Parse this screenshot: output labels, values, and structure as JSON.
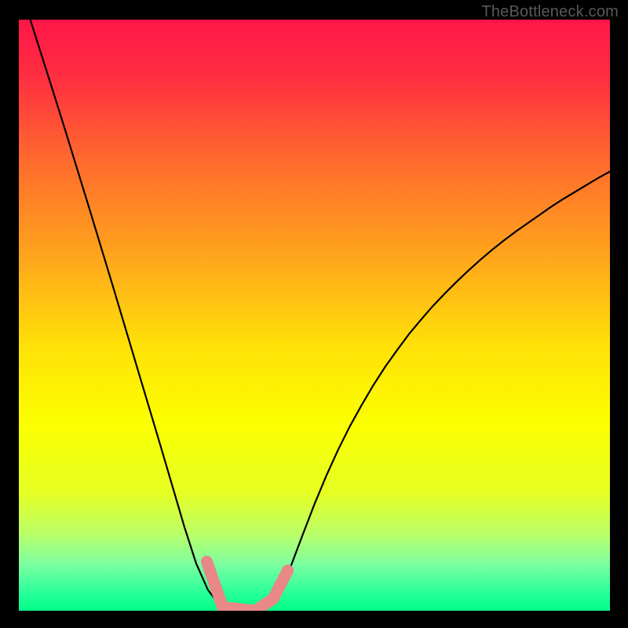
{
  "watermark": "TheBottleneck.com",
  "colors": {
    "gradient_stops": [
      {
        "offset": 0.0,
        "color": "#ff1648"
      },
      {
        "offset": 0.1,
        "color": "#ff2f40"
      },
      {
        "offset": 0.25,
        "color": "#ff6f2c"
      },
      {
        "offset": 0.4,
        "color": "#ffa51c"
      },
      {
        "offset": 0.55,
        "color": "#ffe008"
      },
      {
        "offset": 0.68,
        "color": "#fcff00"
      },
      {
        "offset": 0.8,
        "color": "#e6ff23"
      },
      {
        "offset": 0.87,
        "color": "#baff68"
      },
      {
        "offset": 0.92,
        "color": "#7fffa0"
      },
      {
        "offset": 0.97,
        "color": "#28ff9a"
      },
      {
        "offset": 1.0,
        "color": "#00ff88"
      }
    ],
    "curve_stroke": "#000000",
    "stub_stroke": "#e98886",
    "background": "#000000"
  },
  "chart_data": {
    "type": "line",
    "title": "",
    "xlabel": "",
    "ylabel": "",
    "x": [
      0.0,
      0.02,
      0.04,
      0.06,
      0.08,
      0.1,
      0.12,
      0.14,
      0.16,
      0.18,
      0.2,
      0.22,
      0.24,
      0.26,
      0.28,
      0.3,
      0.32,
      0.34,
      0.355,
      0.37,
      0.385,
      0.4,
      0.42,
      0.44,
      0.46,
      0.48,
      0.5,
      0.52,
      0.54,
      0.56,
      0.58,
      0.6,
      0.62,
      0.64,
      0.66,
      0.68,
      0.7,
      0.72,
      0.74,
      0.76,
      0.78,
      0.8,
      0.82,
      0.84,
      0.86,
      0.88,
      0.9,
      0.92,
      0.94,
      0.96,
      0.98,
      1.0
    ],
    "series": [
      {
        "name": "bottleneck-curve",
        "values": [
          1.06,
          0.998,
          0.935,
          0.872,
          0.808,
          0.743,
          0.678,
          0.612,
          0.546,
          0.479,
          0.412,
          0.345,
          0.278,
          0.21,
          0.142,
          0.08,
          0.035,
          0.009,
          0.0,
          0.0,
          0.0,
          0.0,
          0.006,
          0.03,
          0.075,
          0.128,
          0.18,
          0.228,
          0.272,
          0.312,
          0.348,
          0.382,
          0.413,
          0.441,
          0.468,
          0.492,
          0.515,
          0.536,
          0.556,
          0.575,
          0.593,
          0.61,
          0.626,
          0.641,
          0.655,
          0.669,
          0.683,
          0.696,
          0.708,
          0.72,
          0.732,
          0.743
        ]
      }
    ],
    "xlim": [
      0,
      1
    ],
    "ylim": [
      0,
      1
    ],
    "stub_segments": [
      {
        "x1": 0.318,
        "y1": 0.083,
        "x2": 0.345,
        "y2": 0.006
      },
      {
        "x1": 0.345,
        "y1": 0.006,
        "x2": 0.4,
        "y2": 0.0
      },
      {
        "x1": 0.4,
        "y1": 0.0,
        "x2": 0.43,
        "y2": 0.02
      },
      {
        "x1": 0.43,
        "y1": 0.02,
        "x2": 0.455,
        "y2": 0.068
      }
    ]
  }
}
